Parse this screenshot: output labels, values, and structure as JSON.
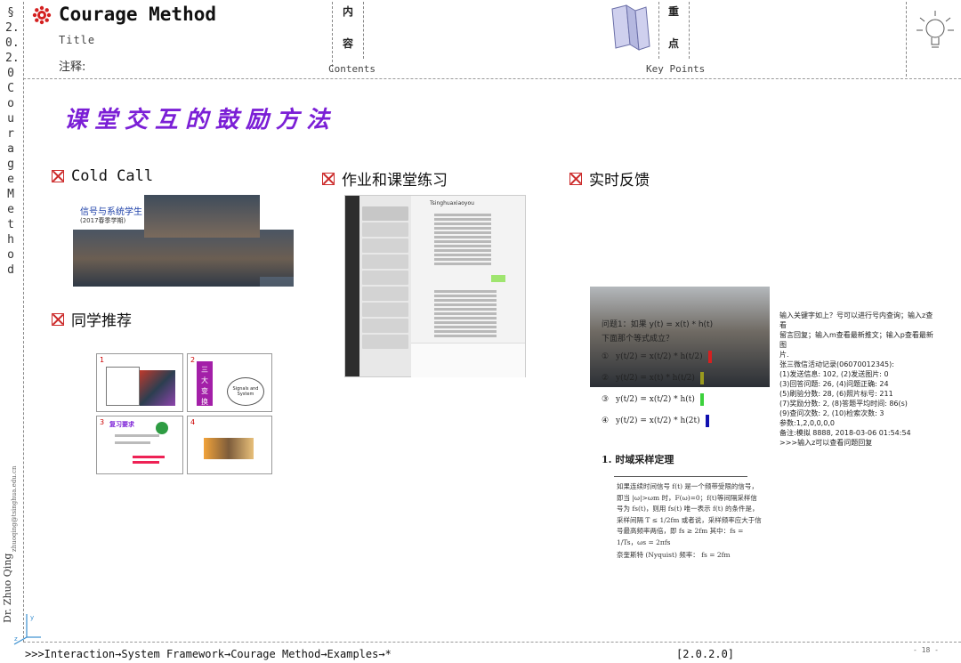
{
  "header": {
    "title": "Courage Method",
    "title_label": "Title",
    "notes_label": "注释:",
    "contents_chars": [
      "内",
      "容"
    ],
    "contents_label": "Contents",
    "keypoints_chars": [
      "重",
      "点"
    ],
    "keypoints_label": "Key Points"
  },
  "sidebar": {
    "section_vertical": "§2.0.2.0 Courage Method",
    "author": "Dr. Zhuo Qing",
    "email": "zhuoqing@tsinghua.edu.cn"
  },
  "slide": {
    "heading": "课堂交互的鼓励方法",
    "sections": [
      {
        "title": "Cold Call"
      },
      {
        "title": "作业和课堂练习"
      },
      {
        "title": "实时反馈"
      },
      {
        "title": "同学推荐"
      }
    ],
    "cold_call_photo": {
      "caption": "信号与系统学生",
      "subcaption": "(2017春季学期)"
    },
    "chat": {
      "title": "Tsinghuaxiaoyou"
    },
    "thumbnails": [
      {
        "num": "1"
      },
      {
        "num": "2",
        "side_text": "三 大 变 换",
        "center_text": "Signals and System"
      },
      {
        "num": "3",
        "title": "复习要求"
      },
      {
        "num": "4"
      }
    ],
    "quiz": {
      "question": "问题1：如果 y(t) = x(t) * h(t)",
      "prompt": "下面那个等式成立？",
      "options": [
        {
          "num": "①",
          "formula": "y(t/2) = x(t/2) * h(t/2)",
          "color": "#d62020"
        },
        {
          "num": "②",
          "formula": "y(t/2) = x(t) * h(t/2)",
          "color": "#9a9a1e"
        },
        {
          "num": "③",
          "formula": "y(t/2) = x(t/2) * h(t)",
          "color": "#3cd13c"
        },
        {
          "num": "④",
          "formula": "y(t/2) = x(t/2) * h(2t)",
          "color": "#1010b0"
        }
      ]
    },
    "log_lines": [
      "输入关键字如上？号可以进行号内查询；输入z查看",
      "留言回复；输入m查看最新推文；输入p查看最新图",
      "片.",
      "张三微信活动记录(06070012345):",
      "(1)发送信息: 102,  (2)发送图片:  0",
      "(3)回答问题:  26,  (4)问题正确:  24",
      "(5)刷验分数:  28,  (6)照片标号: 211",
      "(7)奖励分数:   2,  (8)答题平均时间:  86(s)",
      "(9)查问次数:   2,  (10)检索次数:  3",
      "参数:1,2,0,0,0,0",
      "备注:模拟 8888,  2018-03-06 01:54:54",
      ">>>输入z可以查看问题回复"
    ],
    "theorem": {
      "heading": "1.  时域采样定理",
      "body": "如果连续时间信号 f(t) 是一个频带受限的信号，即当 |ω|>ωm 时，F(ω)=0；f(t)等间隔采样信号为 fs(t)，则用 fs(t) 唯一表示 f(t) 的条件是，采样间隔 T ≤ 1/2fm 或者说，采样频率应大于信号最高频率两倍，即 fs ≥ 2fm 其中：fs = 1/Ts，ωs = 2πfs",
      "nyquist": "奈奎斯特 (Nyquist) 频率： fs = 2fm"
    }
  },
  "footer": {
    "path": ">>>Interaction→System Framework→Courage Method→Examples→*",
    "code": "[2.0.2.0]",
    "page": "- 18 -"
  },
  "colors": {
    "heading": "#7b1fd6",
    "checkbox": "#cc2a2a",
    "logo": "#d42020"
  }
}
